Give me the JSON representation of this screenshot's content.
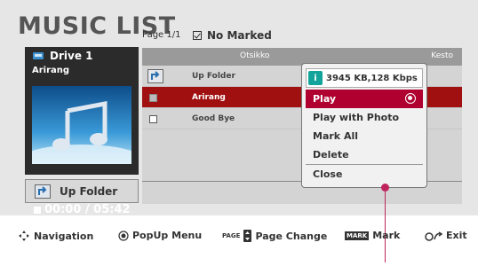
{
  "header": {
    "title": "MUSIC LIST",
    "page": "Page 1/1",
    "marked": "No Marked"
  },
  "drive": {
    "name": "Drive 1",
    "track": "Arirang",
    "time": "00:00 / 05:42",
    "up_folder_label": "Up Folder"
  },
  "list": {
    "columns": {
      "title": "Otsikko",
      "duration": "Kesto"
    },
    "rows": [
      {
        "label": "Up Folder",
        "type": "folder"
      },
      {
        "label": "Arirang",
        "type": "file",
        "selected": true
      },
      {
        "label": "Good Bye",
        "type": "file"
      }
    ]
  },
  "popup": {
    "info_icon_label": "i",
    "bitrate": "3945 KB,128 Kbps",
    "items": [
      "Play",
      "Play with Photo",
      "Mark All",
      "Delete",
      "Close"
    ],
    "active_index": 0
  },
  "footer": {
    "navigation": "Navigation",
    "popup_menu": "PopUp Menu",
    "page_key": "PAGE",
    "page_change": "Page Change",
    "mark_key": "MARK",
    "mark": "Mark",
    "exit": "Exit"
  },
  "colors": {
    "selected_row": "#a01010",
    "menu_active": "#b00030",
    "info_icon": "#12a39a",
    "pointer": "#c0245c"
  }
}
